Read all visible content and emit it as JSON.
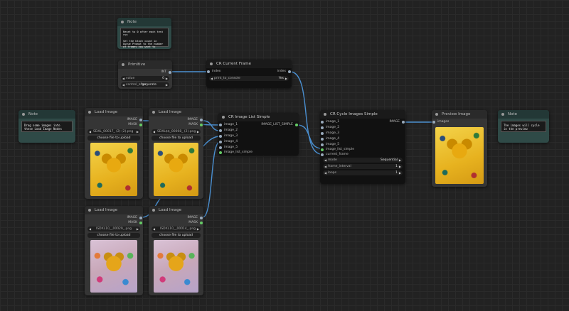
{
  "notes": {
    "top": {
      "title": "Note",
      "text": "Reset to 0 after each test run\n\nSet the btach count in Queue Prompt to the number of frames you want to process"
    },
    "left": {
      "title": "Note",
      "text": "Drag some images into these Load Image Nodes"
    },
    "right": {
      "title": "Note",
      "text": "The images will cycle in the preview"
    }
  },
  "primitive": {
    "title": "Primitive",
    "output": "INT",
    "widgets": [
      {
        "label": "value",
        "value": "0"
      },
      {
        "label": "control_after_",
        "value": "generate"
      }
    ]
  },
  "current_frame": {
    "title": "CR Current Frame",
    "input": "index",
    "output": "index",
    "widget": {
      "label": "print_to_console",
      "value": "Yes"
    }
  },
  "load_images": [
    {
      "title": "Load Image",
      "out1": "IMAGE",
      "out2": "MASK",
      "file": "SDXL_00017_ (2) (2).png",
      "prefix": "SD",
      "upload": "choose file to upload",
      "style": "cat-y"
    },
    {
      "title": "Load Image",
      "out1": "IMAGE",
      "out2": "MASK",
      "file": "SDXL$$_00008_ (2).png",
      "prefix": "",
      "upload": "choose file to upload",
      "style": "cat-y"
    },
    {
      "title": "Load Image",
      "out1": "IMAGE",
      "out2": "MASK",
      "file": "ISDXL10__00029_.png",
      "prefix": "",
      "upload": "choose file to upload",
      "style": "cat-c"
    },
    {
      "title": "Load Image",
      "out1": "IMAGE",
      "out2": "MASK",
      "file": "ISDXL10__00014_.png",
      "prefix": "",
      "upload": "choose file to upload",
      "style": "cat-c"
    }
  ],
  "image_list": {
    "title": "CR Image List Simple",
    "inputs": [
      "image_1",
      "image_2",
      "image_3",
      "image_4",
      "image_5",
      "image_list_simple"
    ],
    "output": "IMAGE_LIST_SIMPLE"
  },
  "cycle": {
    "title": "CR Cycle Images Simple",
    "inputs": [
      "image_1",
      "image_2",
      "image_3",
      "image_4",
      "image_5",
      "image_list_simple",
      "current_frame"
    ],
    "output": "IMAGE",
    "widgets": [
      {
        "label": "mode",
        "value": "Sequential"
      },
      {
        "label": "frame_interval",
        "value": "1"
      },
      {
        "label": "loops",
        "value": "1"
      }
    ]
  },
  "preview": {
    "title": "Preview Image",
    "input": "images"
  },
  "colors": {
    "canvas": "#222222",
    "wire": "#4a8fd0",
    "node": "#353535",
    "note": "#2f4a47"
  }
}
